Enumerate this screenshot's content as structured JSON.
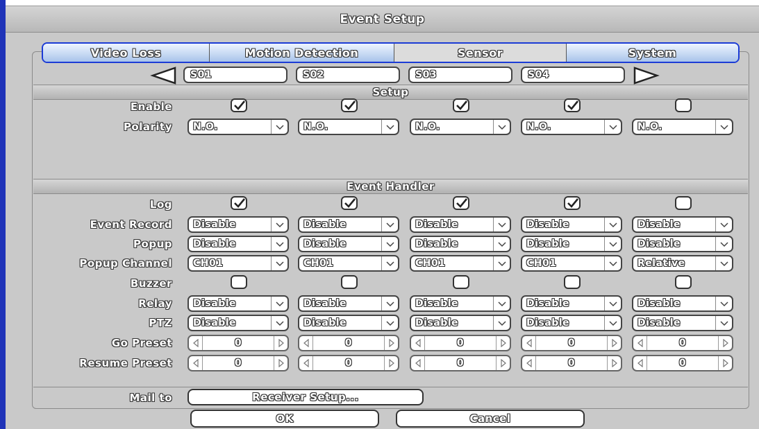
{
  "window": {
    "title": "Event Setup"
  },
  "tabs": [
    {
      "label": "Video Loss",
      "active": false
    },
    {
      "label": "Motion Detection",
      "active": false
    },
    {
      "label": "Sensor",
      "active": true
    },
    {
      "label": "System",
      "active": false
    }
  ],
  "sensors": [
    "S01",
    "S02",
    "S03",
    "S04"
  ],
  "sections": {
    "setup": "Setup",
    "event_handler": "Event Handler"
  },
  "labels": {
    "enable": "Enable",
    "polarity": "Polarity",
    "log": "Log",
    "event_record": "Event Record",
    "popup": "Popup",
    "popup_channel": "Popup Channel",
    "buzzer": "Buzzer",
    "relay": "Relay",
    "ptz": "PTZ",
    "go_preset": "Go Preset",
    "resume_preset": "Resume Preset",
    "mail_to": "Mail to"
  },
  "columns": [
    {
      "enable": true,
      "polarity": "N.O.",
      "log": true,
      "event_record": "Disable",
      "popup": "Disable",
      "popup_channel": "CH01",
      "buzzer": false,
      "relay": "Disable",
      "ptz": "Disable",
      "go_preset": "0",
      "resume_preset": "0"
    },
    {
      "enable": true,
      "polarity": "N.O.",
      "log": true,
      "event_record": "Disable",
      "popup": "Disable",
      "popup_channel": "CH01",
      "buzzer": false,
      "relay": "Disable",
      "ptz": "Disable",
      "go_preset": "0",
      "resume_preset": "0"
    },
    {
      "enable": true,
      "polarity": "N.O.",
      "log": true,
      "event_record": "Disable",
      "popup": "Disable",
      "popup_channel": "CH01",
      "buzzer": false,
      "relay": "Disable",
      "ptz": "Disable",
      "go_preset": "0",
      "resume_preset": "0"
    },
    {
      "enable": true,
      "polarity": "N.O.",
      "log": true,
      "event_record": "Disable",
      "popup": "Disable",
      "popup_channel": "CH01",
      "buzzer": false,
      "relay": "Disable",
      "ptz": "Disable",
      "go_preset": "0",
      "resume_preset": "0"
    },
    {
      "enable": false,
      "polarity": "N.O.",
      "log": false,
      "event_record": "Disable",
      "popup": "Disable",
      "popup_channel": "Relative",
      "buzzer": false,
      "relay": "Disable",
      "ptz": "Disable",
      "go_preset": "0",
      "resume_preset": "0"
    }
  ],
  "buttons": {
    "receiver_setup": "Receiver Setup...",
    "ok": "OK",
    "cancel": "Cancel"
  },
  "colors": {
    "tab_border": "#1b3bd6",
    "window_bg": "#c9c9c9"
  },
  "icons": {
    "prev": "triangle-left-icon",
    "next": "triangle-right-icon",
    "check": "check-icon",
    "dropdown": "chevron-down-icon"
  }
}
